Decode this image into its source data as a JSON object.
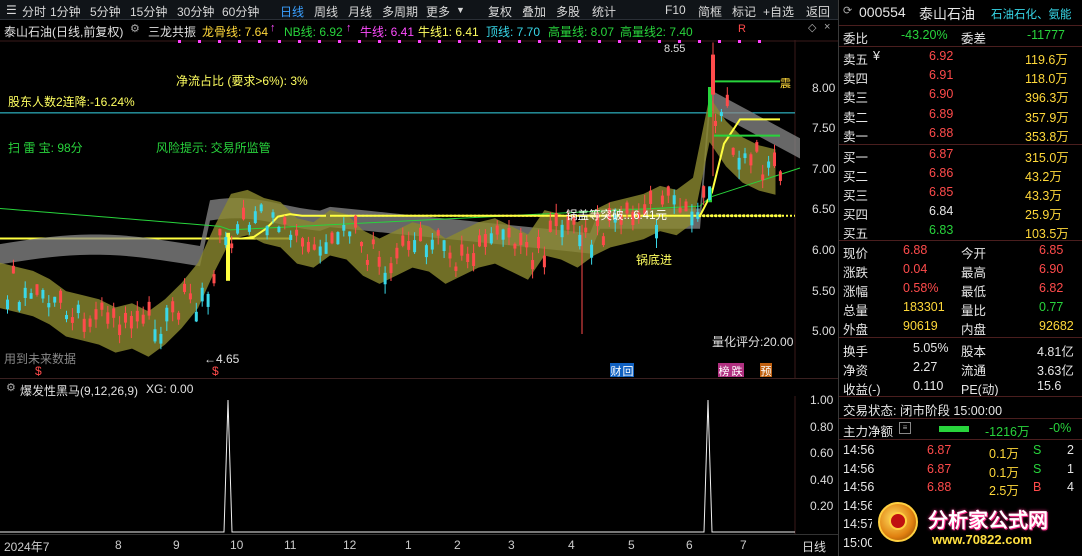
{
  "toolbar": {
    "periods": [
      "分时",
      "1分钟",
      "5分钟",
      "15分钟",
      "30分钟",
      "60分钟",
      "日线",
      "周线",
      "月线",
      "多周期",
      "更多"
    ],
    "active_period": "日线",
    "actions": [
      "复权",
      "叠加",
      "多股",
      "统计",
      "F10",
      "简框",
      "标记",
      "+自选",
      "返回"
    ]
  },
  "infobar": {
    "stock_title": "泰山石油(日线,前复权)",
    "indicator_name": "三龙共振",
    "dragon_line": "龙骨线: 7.64",
    "nb_line": "NB线: 6.92",
    "bull_line": "牛线: 6.41",
    "bull_line1": "牛线1: 6.41",
    "top_line": "顶线: 7.70",
    "volume_line": "高量线: 8.07",
    "volume_line2": "高量线2: 7.40",
    "arrow_up": "↑",
    "marker": "R"
  },
  "chart_annotations": {
    "net_flow": "净流占比 (要求>6%):  3%",
    "holders": "股东人数2连降:-16.24%",
    "thunder": "扫 雷 宝:   98分",
    "risk": "风险提示:   交易所监管",
    "future_data": "用到未来数据",
    "low_label": "←4.65",
    "high_label": "8.55",
    "breakout": "锅盖等突破...6.41元",
    "pot_bottom": "锅底进",
    "quant_score": "量化评分:20.00",
    "dollar1": "$",
    "dollar2": "$",
    "tag_finance": "财",
    "tag_huifu": "回",
    "tag_rank": "榜",
    "tag_fall": "跌",
    "tag_forecast": "预",
    "side_label": "震"
  },
  "price_axis": [
    "8.00",
    "7.50",
    "7.00",
    "6.50",
    "6.00",
    "5.50",
    "5.00"
  ],
  "sub_header": {
    "name": "爆发性黑马(9,12,26,9)",
    "xg": "XG: 0.00"
  },
  "sub_axis": [
    "1.00",
    "0.80",
    "0.60",
    "0.40",
    "0.20"
  ],
  "xaxis": {
    "labels": [
      "2024年7",
      "8",
      "9",
      "10",
      "11",
      "12",
      "1",
      "2",
      "3",
      "4",
      "5",
      "6",
      "7"
    ],
    "period": "日线"
  },
  "chart_data": {
    "type": "candlestick",
    "title": "泰山石油(日线,前复权)",
    "ylim": [
      4.5,
      8.7
    ],
    "lines": {
      "dragon_bone": 7.64,
      "nb": 6.92,
      "bull": 6.41,
      "bull1": 6.41,
      "top": 7.7,
      "high_volume": 8.07,
      "high_volume2": 7.4
    },
    "annotated_points": {
      "low": 4.65,
      "high": 8.55,
      "breakout": 6.41
    },
    "sub_chart": {
      "name": "爆发性黑马(9,12,26,9)",
      "xg": 0.0,
      "ylim": [
        0,
        1.0
      ],
      "signals": 2
    }
  },
  "panel": {
    "code": "000554",
    "name": "泰山石油",
    "sector": "石油石化、氨能",
    "weibi_label": "委比",
    "weibi_value": "-43.20%",
    "weicha_label": "委差",
    "weicha_value": "-11777",
    "asks": [
      {
        "label": "卖五",
        "price": "6.92",
        "vol": "119.6万",
        "flag": "¥"
      },
      {
        "label": "卖四",
        "price": "6.91",
        "vol": "118.0万"
      },
      {
        "label": "卖三",
        "price": "6.90",
        "vol": "396.3万"
      },
      {
        "label": "卖二",
        "price": "6.89",
        "vol": "357.9万"
      },
      {
        "label": "卖一",
        "price": "6.88",
        "vol": "353.8万"
      }
    ],
    "bids": [
      {
        "label": "买一",
        "price": "6.87",
        "vol": "315.0万"
      },
      {
        "label": "买二",
        "price": "6.86",
        "vol": "43.2万"
      },
      {
        "label": "买三",
        "price": "6.85",
        "vol": "43.3万"
      },
      {
        "label": "买四",
        "price": "6.84",
        "vol": "25.9万"
      },
      {
        "label": "买五",
        "price": "6.83",
        "vol": "103.5万"
      }
    ],
    "quote": [
      {
        "l1": "现价",
        "v1": "6.88",
        "l2": "今开",
        "v2": "6.85"
      },
      {
        "l1": "涨跌",
        "v1": "0.04",
        "l2": "最高",
        "v2": "6.90"
      },
      {
        "l1": "涨幅",
        "v1": "0.58%",
        "l2": "最低",
        "v2": "6.82"
      },
      {
        "l1": "总量",
        "v1": "183301",
        "l2": "量比",
        "v2": "0.77"
      },
      {
        "l1": "外盘",
        "v1": "90619",
        "l2": "内盘",
        "v2": "92682"
      }
    ],
    "fund": [
      {
        "l1": "换手",
        "v1": "5.05%",
        "l2": "股本",
        "v2": "4.81亿"
      },
      {
        "l1": "净资",
        "v1": "2.27",
        "l2": "流通",
        "v2": "3.63亿"
      },
      {
        "l1": "收益(-)",
        "v1": "0.110",
        "l2": "PE(动)",
        "v2": "15.6"
      }
    ],
    "trade_status": "交易状态: 闭市阶段 15:00:00",
    "main_net_label": "主力净额",
    "main_net_value": "-1216万",
    "main_net_change": "-0%",
    "ticks": [
      {
        "time": "14:56",
        "price": "6.87",
        "vol": "0.1万",
        "side": "S",
        "count": "2"
      },
      {
        "time": "14:56",
        "price": "6.87",
        "vol": "0.1万",
        "side": "S",
        "count": "1"
      },
      {
        "time": "14:56",
        "price": "6.88",
        "vol": "2.5万",
        "side": "B",
        "count": "4"
      },
      {
        "time": "14:56",
        "price": "",
        "vol": "",
        "side": "",
        "count": ""
      },
      {
        "time": "14:57",
        "price": "",
        "vol": "",
        "side": "",
        "count": ""
      },
      {
        "time": "15:00",
        "price": "",
        "vol": "",
        "side": "",
        "count": ""
      }
    ]
  },
  "brand": {
    "name": "分析家公式网",
    "url": "www.70822.com"
  },
  "colors": {
    "up": "#ff4b4b",
    "down": "#28d43c",
    "bull": "#ffff40",
    "band": "#8a8a2a",
    "cloud": "#9a9a9a",
    "accent": "#3aa0ff"
  }
}
